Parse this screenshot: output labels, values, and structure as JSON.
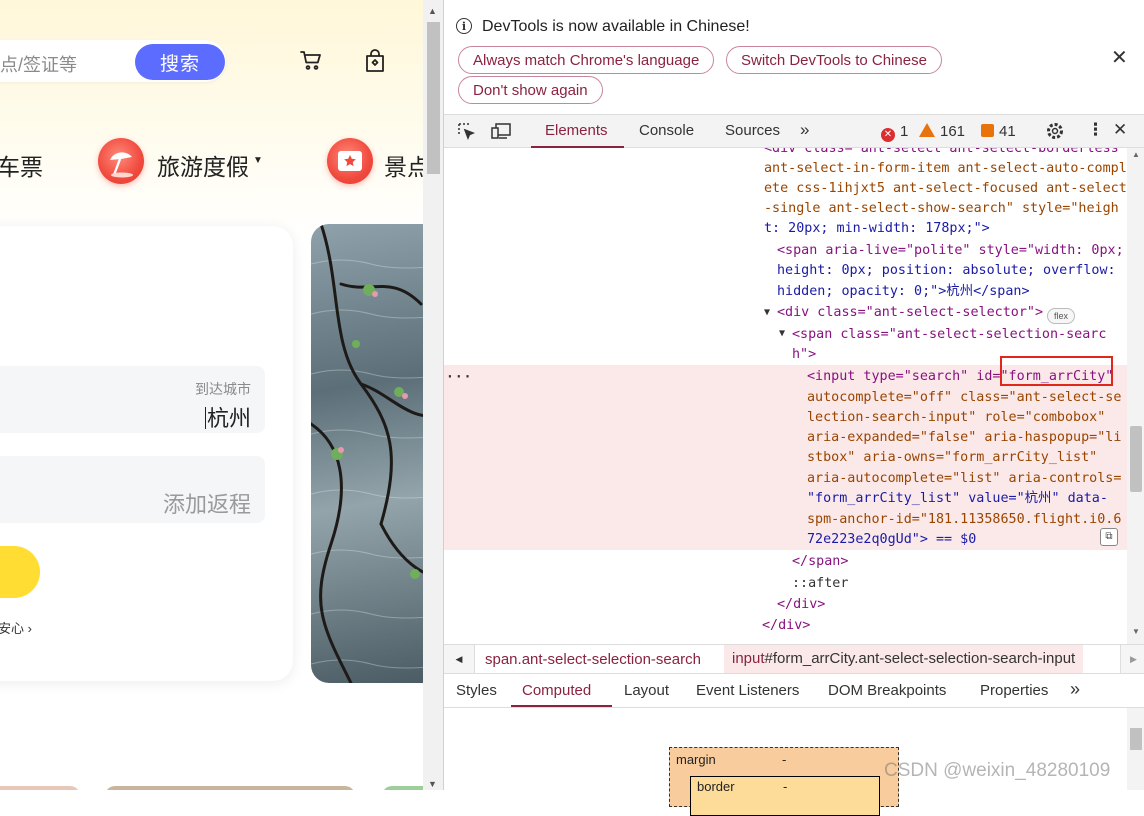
{
  "page": {
    "search_placeholder": "点/签证等",
    "search_button": "搜索",
    "nav": {
      "train_partial": "车票",
      "tour": "旅游度假",
      "scenic_partial": "景点"
    },
    "form": {
      "arrive_label": "到达城市",
      "arrive_value": "杭州",
      "return_placeholder": "添加返程",
      "reassure_partial": "安心"
    }
  },
  "devtools": {
    "infobar": {
      "message": "DevTools is now available in Chinese!",
      "btn_match": "Always match Chrome's language",
      "btn_switch": "Switch DevTools to Chinese",
      "btn_dont_show": "Don't show again"
    },
    "tabs": [
      "Elements",
      "Console",
      "Sources"
    ],
    "active_tab": "Elements",
    "counts": {
      "errors": "1",
      "warnings": "161",
      "issues": "41"
    },
    "colors": {
      "accent": "#8a2340",
      "error": "#dc2e2e",
      "warning": "#e8730c",
      "highlight": "#e0271b"
    },
    "dom_lines": [
      "<div class=\"ant-select ant-select-borderless",
      "ant-select-in-form-item ant-select-auto-compl",
      "ete css-1ihjxt5 ant-select-focused ant-select",
      "-single ant-select-show-search\" style=\"heigh",
      "t: 20px; min-width: 178px;\">",
      "<span aria-live=\"polite\" style=\"width: 0px;",
      "height: 0px; position: absolute; overflow:",
      "hidden; opacity: 0;\">杭州</span>",
      "<div class=\"ant-select-selector\">",
      "<span class=\"ant-select-selection-searc",
      "h\">",
      "<input type=\"search\" id=\"form_arrCity\"",
      "autocomplete=\"off\" class=\"ant-select-se",
      "lection-search-input\" role=\"combobox\"",
      "aria-expanded=\"false\" aria-haspopup=\"li",
      "stbox\" aria-owns=\"form_arrCity_list\"",
      "aria-autocomplete=\"list\" aria-controls=",
      "\"form_arrCity_list\" value=\"杭州\" data-",
      "spm-anchor-id=\"181.11358650.flight.i0.6",
      "72e223e2q0gUd\"> == $0",
      "</span>",
      "::after",
      "</div>",
      "</div>"
    ],
    "flex_badge": "flex",
    "breadcrumbs": {
      "first": "span.ant-select-selection-search",
      "second_tag": "input",
      "second_rest": "#form_arrCity.ant-select-selection-search-input"
    },
    "subtabs": [
      "Styles",
      "Computed",
      "Layout",
      "Event Listeners",
      "DOM Breakpoints",
      "Properties"
    ],
    "active_subtab": "Computed",
    "boxmodel": {
      "margin_label": "margin",
      "margin_value": "-",
      "border_label": "border",
      "border_value": "-"
    }
  },
  "watermark": "CSDN @weixin_48280109"
}
